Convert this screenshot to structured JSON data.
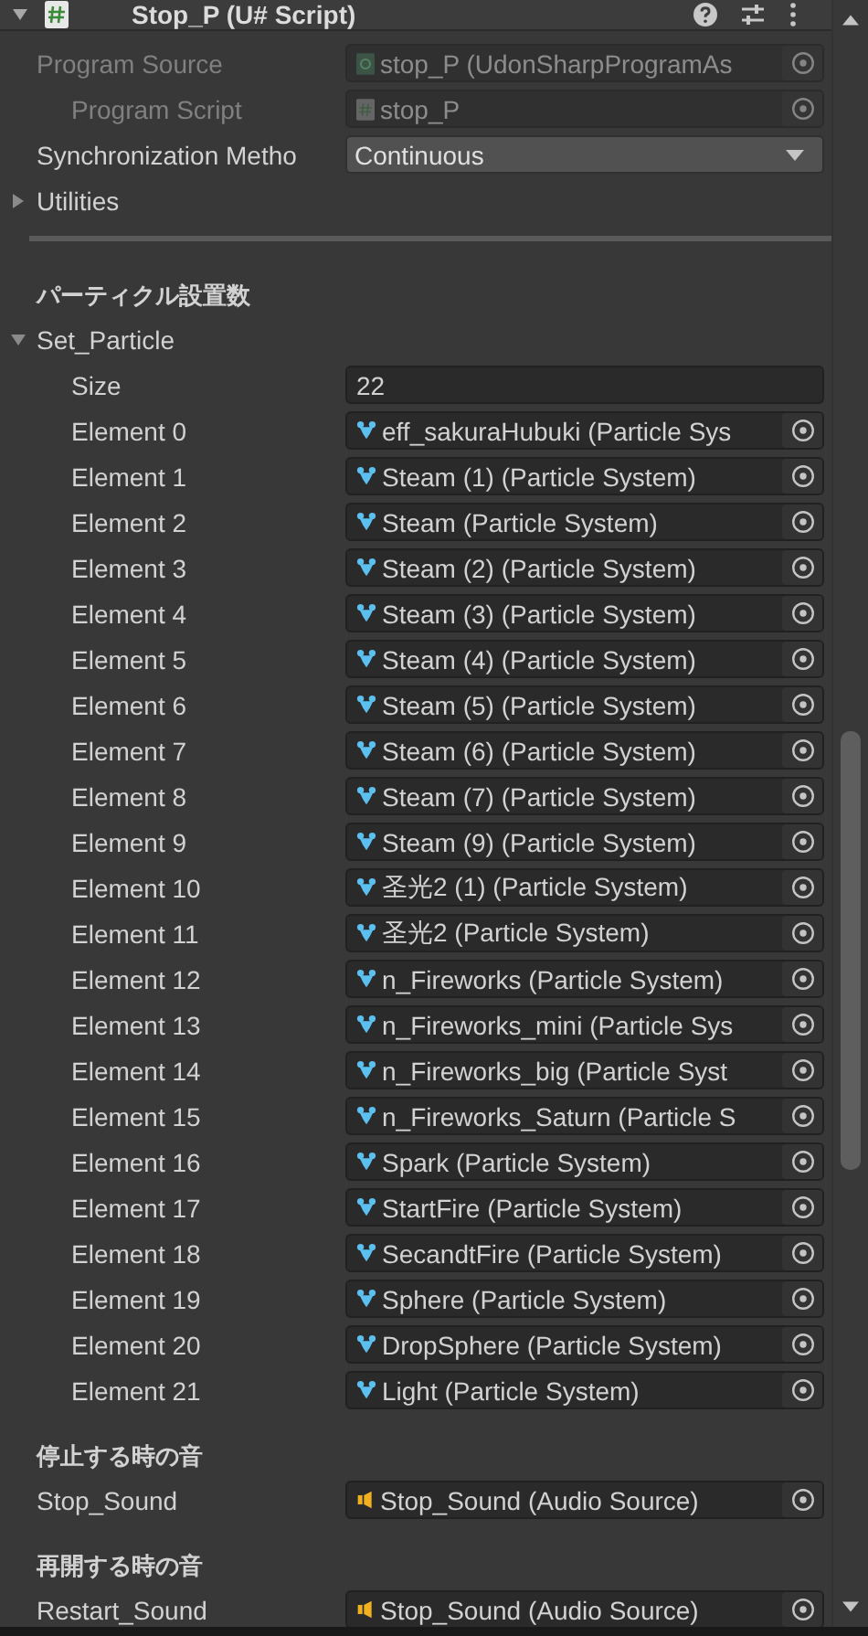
{
  "component": {
    "title": "Stop_P (U# Script)",
    "expanded": true
  },
  "properties": [
    {
      "kind": "program_asset",
      "label": "Program Source",
      "value": "stop_P (UdonSharpProgramAs",
      "disabled": true,
      "children": [
        {
          "kind": "script",
          "label": "Program Script",
          "value": "stop_P",
          "disabled": true
        }
      ]
    },
    {
      "kind": "dropdown",
      "label": "Synchronization Metho",
      "value": "Continuous"
    },
    {
      "kind": "foldout",
      "label": "Utilities",
      "expanded": false
    },
    {
      "kind": "separator"
    },
    {
      "kind": "header",
      "label": "パーティクル設置数"
    },
    {
      "kind": "foldout",
      "label": "Set_Particle",
      "expanded": true,
      "children": [
        {
          "kind": "int",
          "label": "Size",
          "value": "22"
        },
        {
          "kind": "particle",
          "label": "Element 0",
          "value": "eff_sakuraHubuki (Particle Sys",
          "disabled": false
        },
        {
          "kind": "particle",
          "label": "Element 1",
          "value": "Steam (1) (Particle System)",
          "disabled": false
        },
        {
          "kind": "particle",
          "label": "Element 2",
          "value": "Steam (Particle System)",
          "disabled": false
        },
        {
          "kind": "particle",
          "label": "Element 3",
          "value": "Steam (2) (Particle System)",
          "disabled": false
        },
        {
          "kind": "particle",
          "label": "Element 4",
          "value": "Steam (3) (Particle System)",
          "disabled": false
        },
        {
          "kind": "particle",
          "label": "Element 5",
          "value": "Steam (4) (Particle System)",
          "disabled": false
        },
        {
          "kind": "particle",
          "label": "Element 6",
          "value": "Steam (5) (Particle System)",
          "disabled": false
        },
        {
          "kind": "particle",
          "label": "Element 7",
          "value": "Steam (6) (Particle System)",
          "disabled": false
        },
        {
          "kind": "particle",
          "label": "Element 8",
          "value": "Steam (7) (Particle System)",
          "disabled": false
        },
        {
          "kind": "particle",
          "label": "Element 9",
          "value": "Steam (9) (Particle System)",
          "disabled": false
        },
        {
          "kind": "particle",
          "label": "Element 10",
          "value": "圣光2 (1) (Particle System)",
          "disabled": false
        },
        {
          "kind": "particle",
          "label": "Element 11",
          "value": "圣光2 (Particle System)",
          "disabled": false
        },
        {
          "kind": "particle",
          "label": "Element 12",
          "value": "n_Fireworks (Particle System)",
          "disabled": false
        },
        {
          "kind": "particle",
          "label": "Element 13",
          "value": "n_Fireworks_mini (Particle Sys",
          "disabled": false
        },
        {
          "kind": "particle",
          "label": "Element 14",
          "value": "n_Fireworks_big (Particle Syst",
          "disabled": false
        },
        {
          "kind": "particle",
          "label": "Element 15",
          "value": "n_Fireworks_Saturn (Particle S",
          "disabled": false
        },
        {
          "kind": "particle",
          "label": "Element 16",
          "value": "Spark (Particle System)",
          "disabled": false
        },
        {
          "kind": "particle",
          "label": "Element 17",
          "value": "StartFire (Particle System)",
          "disabled": false
        },
        {
          "kind": "particle",
          "label": "Element 18",
          "value": "SecandtFire (Particle System)",
          "disabled": false
        },
        {
          "kind": "particle",
          "label": "Element 19",
          "value": "Sphere (Particle System)",
          "disabled": false
        },
        {
          "kind": "particle",
          "label": "Element 20",
          "value": "DropSphere (Particle System)",
          "disabled": false
        },
        {
          "kind": "particle",
          "label": "Element 21",
          "value": "Light (Particle System)",
          "disabled": false
        }
      ]
    },
    {
      "kind": "header",
      "label": "停止する時の音"
    },
    {
      "kind": "audio",
      "label": "Stop_Sound",
      "value": "Stop_Sound (Audio Source)",
      "disabled": false
    },
    {
      "kind": "header",
      "label": "再開する時の音"
    },
    {
      "kind": "audio",
      "label": "Restart_Sound",
      "value": "Stop_Sound (Audio Source)",
      "disabled": false
    }
  ]
}
